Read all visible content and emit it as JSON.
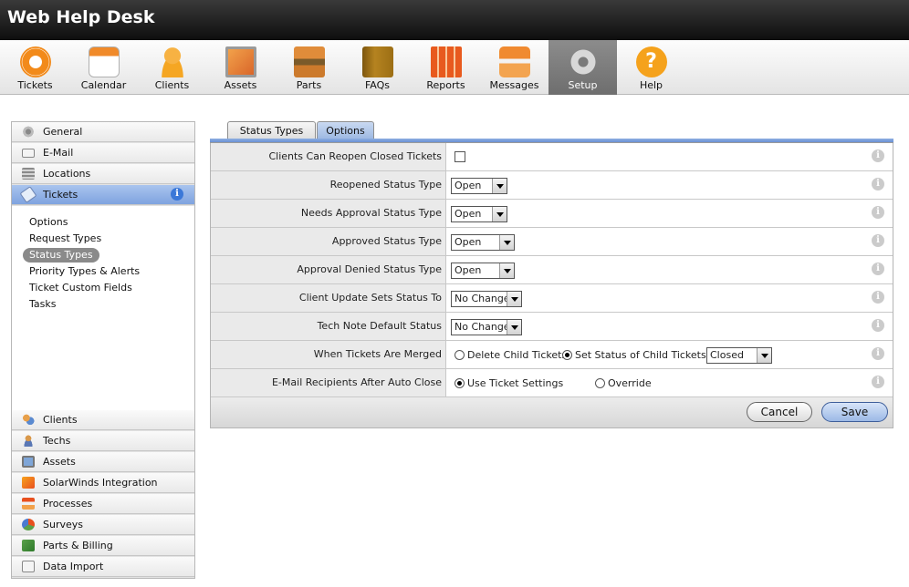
{
  "app": {
    "title": "Web Help Desk"
  },
  "toolbar": {
    "items": [
      {
        "label": "Tickets",
        "icon": "lifebuoy-icon",
        "color": "#f28a1a"
      },
      {
        "label": "Calendar",
        "icon": "calendar-icon",
        "color": "#f3b640"
      },
      {
        "label": "Clients",
        "icon": "person-icon",
        "color": "#f5a623"
      },
      {
        "label": "Assets",
        "icon": "monitor-icon",
        "color": "#e3843a"
      },
      {
        "label": "Parts",
        "icon": "toolbox-icon",
        "color": "#cc7a2c"
      },
      {
        "label": "FAQs",
        "icon": "book-icon",
        "color": "#a97818"
      },
      {
        "label": "Reports",
        "icon": "report-icon",
        "color": "#e85a1e"
      },
      {
        "label": "Messages",
        "icon": "messages-icon",
        "color": "#f08a30"
      },
      {
        "label": "Setup",
        "icon": "gear-icon",
        "color": "#cfcfcf",
        "active": true
      },
      {
        "label": "Help",
        "icon": "help-icon",
        "color": "#f5a21c"
      }
    ]
  },
  "sidebar": {
    "top_items": [
      {
        "label": "General",
        "icon": "gear-icon"
      },
      {
        "label": "E-Mail",
        "icon": "envelope-icon"
      },
      {
        "label": "Locations",
        "icon": "building-icon"
      },
      {
        "label": "Tickets",
        "icon": "tag-icon",
        "active": true,
        "badge": "i"
      }
    ],
    "sub_items": [
      {
        "label": "Options"
      },
      {
        "label": "Request Types"
      },
      {
        "label": "Status Types",
        "active": true
      },
      {
        "label": "Priority Types & Alerts"
      },
      {
        "label": "Ticket Custom Fields"
      },
      {
        "label": "Tasks"
      }
    ],
    "bottom_items": [
      {
        "label": "Clients",
        "icon": "clients-icon"
      },
      {
        "label": "Techs",
        "icon": "tech-icon"
      },
      {
        "label": "Assets",
        "icon": "monitor-icon"
      },
      {
        "label": "SolarWinds Integration",
        "icon": "solarwinds-icon"
      },
      {
        "label": "Processes",
        "icon": "process-icon"
      },
      {
        "label": "Surveys",
        "icon": "survey-icon"
      },
      {
        "label": "Parts & Billing",
        "icon": "parts-icon"
      },
      {
        "label": "Data Import",
        "icon": "import-icon"
      }
    ]
  },
  "tabs": [
    {
      "label": "Status Types"
    },
    {
      "label": "Options",
      "active": true
    }
  ],
  "form": {
    "rows": [
      {
        "label": "Clients Can Reopen Closed Tickets",
        "type": "checkbox",
        "checked": false
      },
      {
        "label": "Reopened Status Type",
        "type": "select",
        "value": "Open"
      },
      {
        "label": "Needs Approval Status Type",
        "type": "select",
        "value": "Open"
      },
      {
        "label": "Approved Status Type",
        "type": "select",
        "value": "Open"
      },
      {
        "label": "Approval Denied Status Type",
        "type": "select",
        "value": "Open"
      },
      {
        "label": "Client Update Sets Status To",
        "type": "select",
        "value": "No Change"
      },
      {
        "label": "Tech Note Default Status",
        "type": "select",
        "value": "No Change"
      },
      {
        "label": "When Tickets Are Merged",
        "type": "radio",
        "options": [
          "Delete Child Tickets",
          "Set Status of Child Tickets to"
        ],
        "selected": 1,
        "select_value": "Closed"
      },
      {
        "label": "E-Mail Recipients After Auto Close",
        "type": "radio",
        "options": [
          "Use Ticket Settings",
          "Override"
        ],
        "selected": 0
      }
    ],
    "info_glyph": "i",
    "cancel_label": "Cancel",
    "save_label": "Save"
  }
}
